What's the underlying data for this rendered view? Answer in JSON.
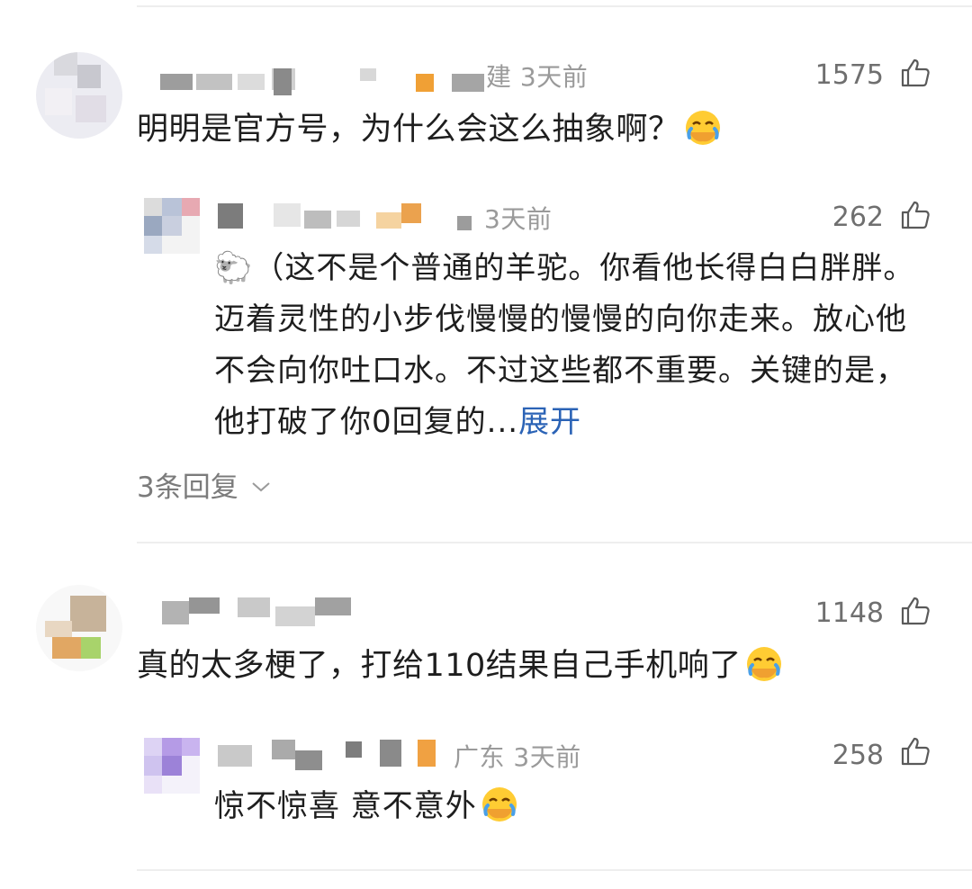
{
  "comments": [
    {
      "meta": "建 3天前",
      "likes": "1575",
      "text": "明明是官方号，为什么会这么抽象啊？",
      "reply": {
        "meta": "3天前",
        "likes": "262",
        "emoji_prefix": "🐑",
        "text": "（这不是个普通的羊驼。你看他长得白白胖胖。迈着灵性的小步伐慢慢的慢慢的向你走来。放心他不会向你吐口水。不过这些都不重要。关键的是，他打破了你0回复的...",
        "expand_label": "展开"
      },
      "replies_link": "3条回复"
    },
    {
      "likes": "1148",
      "text": "真的太多梗了，打给110结果自己手机响了",
      "reply": {
        "meta": "广东 3天前",
        "likes": "258",
        "text": "惊不惊喜 意不意外"
      }
    }
  ],
  "colors": {
    "accent": "#2b63b6",
    "muted": "#9a9a9a",
    "text": "#1e1e1e"
  },
  "icons": [
    "thumbs-up-icon",
    "face-palm-emoji-icon",
    "sheep-emoji-icon",
    "chevron-down-icon"
  ]
}
